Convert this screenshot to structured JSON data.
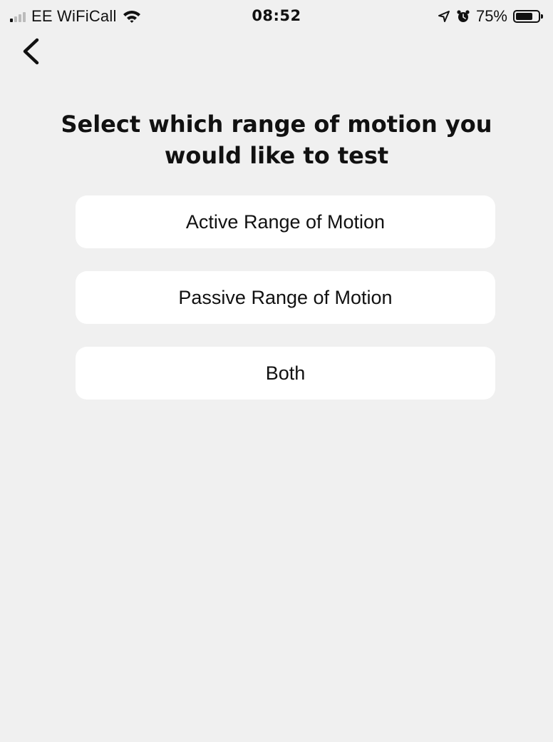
{
  "status_bar": {
    "carrier": "EE WiFiCall",
    "time": "08:52",
    "battery_percent": "75%",
    "battery_level": 0.75,
    "signal_icon": "cellular-signal-icon",
    "wifi_icon": "wifi-icon",
    "location_icon": "location-arrow-icon",
    "alarm_icon": "alarm-clock-icon"
  },
  "nav": {
    "back_icon": "chevron-left-icon"
  },
  "page": {
    "title": "Select which range of motion you would like to test"
  },
  "options": [
    {
      "label": "Active Range of Motion"
    },
    {
      "label": "Passive Range of Motion"
    },
    {
      "label": "Both"
    }
  ],
  "colors": {
    "background": "#f0f0f0",
    "card": "#ffffff",
    "text": "#111111"
  }
}
